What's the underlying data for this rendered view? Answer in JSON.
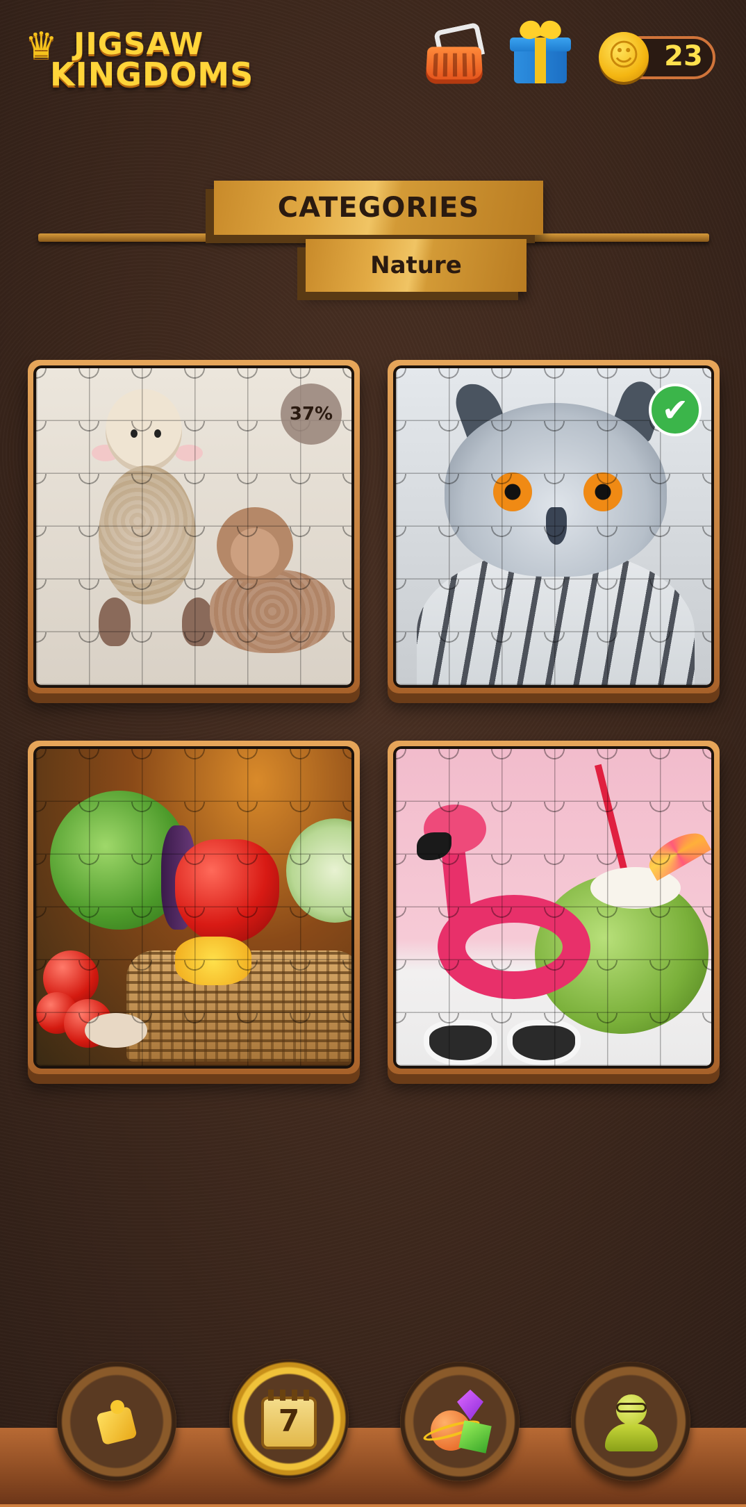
{
  "app": {
    "logo_line1": "JIGSAW",
    "logo_line2": "KINGDOMS"
  },
  "header": {
    "shop_icon": "basket-icon",
    "gift_icon": "gift-icon",
    "coins": "23",
    "coin_icon": "coin-icon"
  },
  "title": {
    "main": "CATEGORIES",
    "sub": "Nature"
  },
  "puzzles": [
    {
      "subject": "crochet sheep",
      "progress": "37%",
      "completed": false
    },
    {
      "subject": "owl",
      "progress": null,
      "completed": true
    },
    {
      "subject": "vegetable basket",
      "progress": null,
      "completed": false
    },
    {
      "subject": "flamingo and coconut",
      "progress": null,
      "completed": false
    }
  ],
  "nav": {
    "items": [
      {
        "icon": "puzzle-piece-icon",
        "active": false
      },
      {
        "icon": "daily-calendar-icon",
        "label": "7",
        "active": true
      },
      {
        "icon": "planet-collection-icon",
        "active": false
      },
      {
        "icon": "profile-icon",
        "active": false
      }
    ]
  },
  "colors": {
    "accent_gold": "#f5c21c",
    "check_green": "#3bb54a",
    "background": "#3c271c"
  }
}
